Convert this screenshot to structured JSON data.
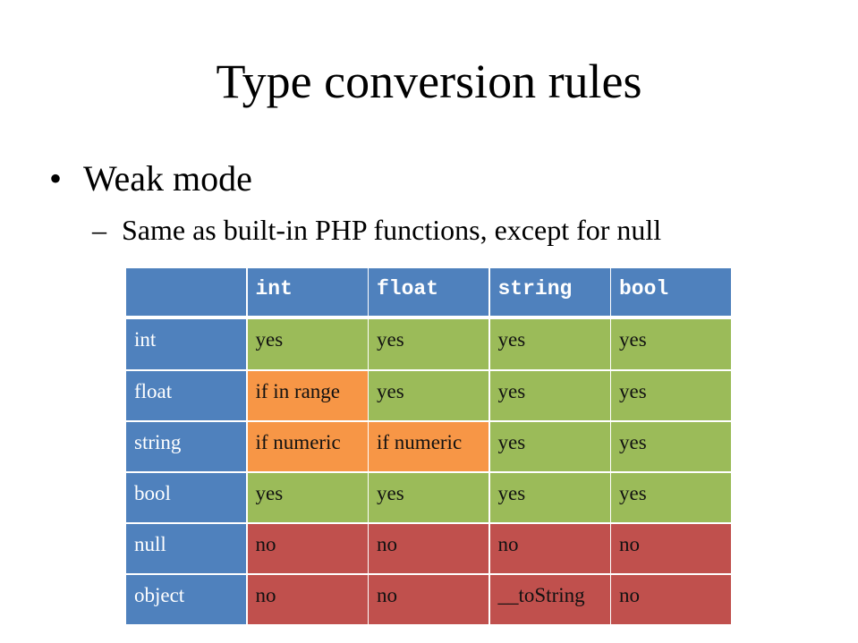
{
  "slide": {
    "title": "Type conversion rules",
    "bullet": {
      "marker": "•",
      "text": "Weak mode"
    },
    "subbullet": {
      "marker": "–",
      "text": "Same as built-in PHP functions, except for null"
    }
  },
  "table": {
    "corner": "",
    "columns": [
      "int",
      "float",
      "string",
      "bool"
    ],
    "rows": [
      {
        "label": "int",
        "cells": [
          "yes",
          "yes",
          "yes",
          "yes"
        ],
        "status": [
          "yes",
          "yes",
          "yes",
          "yes"
        ]
      },
      {
        "label": "float",
        "cells": [
          "if in range",
          "yes",
          "yes",
          "yes"
        ],
        "status": [
          "cond",
          "yes",
          "yes",
          "yes"
        ]
      },
      {
        "label": "string",
        "cells": [
          "if numeric",
          "if numeric",
          "yes",
          "yes"
        ],
        "status": [
          "cond",
          "cond",
          "yes",
          "yes"
        ]
      },
      {
        "label": "bool",
        "cells": [
          "yes",
          "yes",
          "yes",
          "yes"
        ],
        "status": [
          "yes",
          "yes",
          "yes",
          "yes"
        ]
      },
      {
        "label": "null",
        "cells": [
          "no",
          "no",
          "no",
          "no"
        ],
        "status": [
          "no",
          "no",
          "no",
          "no"
        ]
      },
      {
        "label": "object",
        "cells": [
          "no",
          "no",
          "__toString",
          "no"
        ],
        "status": [
          "no",
          "no",
          "no",
          "no"
        ]
      }
    ]
  },
  "colors": {
    "header": "#4f81bd",
    "yes": "#9bbb59",
    "cond": "#f79646",
    "no": "#c0504d"
  }
}
